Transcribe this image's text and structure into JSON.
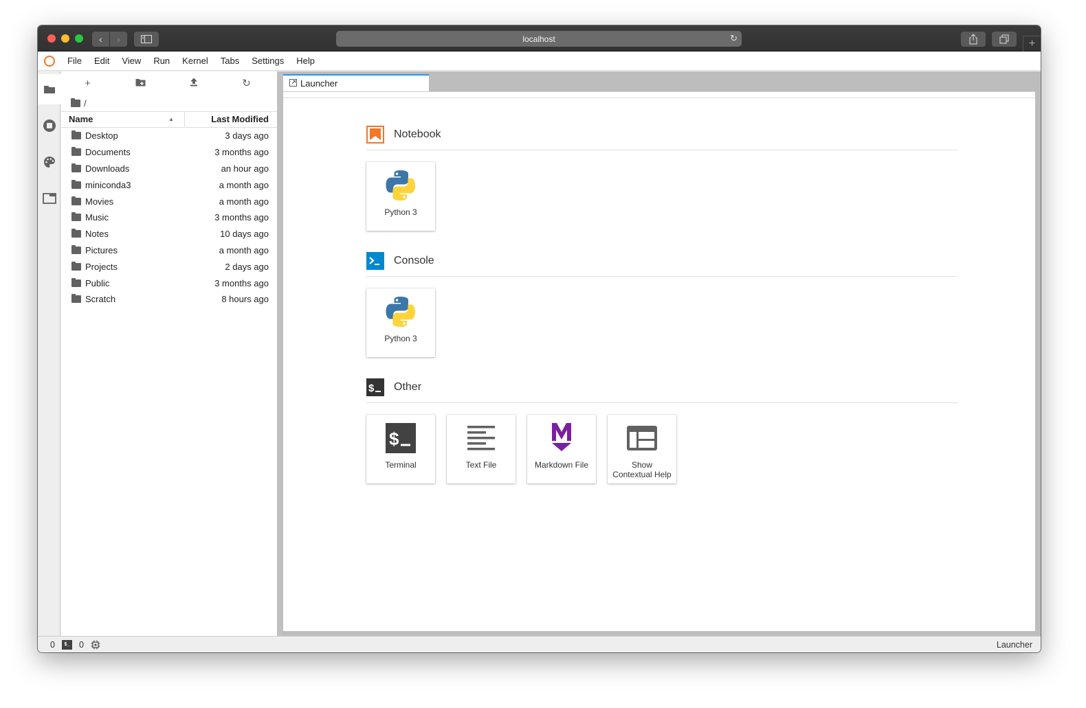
{
  "browser": {
    "address": "localhost",
    "nav_back": "‹",
    "nav_forward": "›"
  },
  "menubar": {
    "items": [
      "File",
      "Edit",
      "View",
      "Run",
      "Kernel",
      "Tabs",
      "Settings",
      "Help"
    ]
  },
  "rail": {
    "items": [
      {
        "name": "file-browser",
        "icon": "folder-icon",
        "active": true
      },
      {
        "name": "running-kernels",
        "icon": "stop-circle-icon",
        "active": false
      },
      {
        "name": "commands",
        "icon": "palette-icon",
        "active": false
      },
      {
        "name": "open-tabs",
        "icon": "tab-icon",
        "active": false
      }
    ]
  },
  "filebrowser": {
    "toolbar": {
      "new_launcher": "+",
      "new_folder": "new-folder-icon",
      "upload": "upload-icon",
      "refresh": "refresh-icon"
    },
    "breadcrumb": "/",
    "columns": {
      "name": "Name",
      "modified": "Last Modified",
      "sort": "ascending"
    },
    "rows": [
      {
        "name": "Desktop",
        "modified": "3 days ago"
      },
      {
        "name": "Documents",
        "modified": "3 months ago"
      },
      {
        "name": "Downloads",
        "modified": "an hour ago"
      },
      {
        "name": "miniconda3",
        "modified": "a month ago"
      },
      {
        "name": "Movies",
        "modified": "a month ago"
      },
      {
        "name": "Music",
        "modified": "3 months ago"
      },
      {
        "name": "Notes",
        "modified": "10 days ago"
      },
      {
        "name": "Pictures",
        "modified": "a month ago"
      },
      {
        "name": "Projects",
        "modified": "2 days ago"
      },
      {
        "name": "Public",
        "modified": "3 months ago"
      },
      {
        "name": "Scratch",
        "modified": "8 hours ago"
      }
    ]
  },
  "tab": {
    "label": "Launcher",
    "accent": "#2196f3"
  },
  "launcher": {
    "sections": [
      {
        "title": "Notebook",
        "color": "#f37726",
        "cards": [
          {
            "label": "Python 3",
            "icon": "python-icon"
          }
        ]
      },
      {
        "title": "Console",
        "color": "#0288d1",
        "cards": [
          {
            "label": "Python 3",
            "icon": "python-icon"
          }
        ]
      },
      {
        "title": "Other",
        "color": "#333333",
        "cards": [
          {
            "label": "Terminal",
            "icon": "terminal-icon"
          },
          {
            "label": "Text File",
            "icon": "text-file-icon"
          },
          {
            "label": "Markdown File",
            "icon": "markdown-icon"
          },
          {
            "label": "Show Contextual Help",
            "label_line1": "Show",
            "label_line2": "Contextual Help",
            "icon": "contextual-help-icon"
          }
        ]
      }
    ]
  },
  "statusbar": {
    "kernels_count": "0",
    "terminals_count": "0",
    "terminal_glyph": "$_",
    "mode": "Launcher"
  }
}
